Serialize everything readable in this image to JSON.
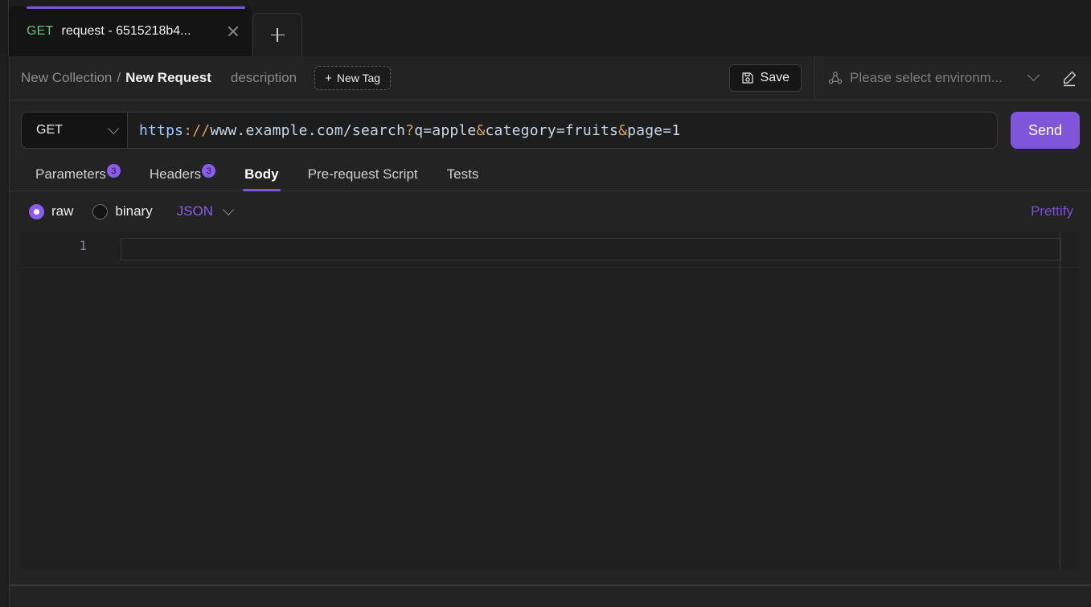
{
  "tabbar": {
    "tabs": [
      {
        "method": "GET",
        "title": "request - 6515218b4...",
        "close_icon": "close-icon",
        "active": true
      }
    ],
    "new_tab_icon": "plus-icon"
  },
  "header": {
    "collection": "New Collection",
    "separator": "/",
    "request_name": "New Request",
    "description_placeholder": "description",
    "new_tag": {
      "plus": "+",
      "label": "New Tag"
    },
    "save": {
      "label": "Save",
      "icon": "floppy-disk-icon"
    },
    "environment": {
      "icon": "environment-node-icon",
      "placeholder": "Please select environm...",
      "chevron_icon": "chevron-down-icon"
    },
    "edit_icon": "pencil-edit-icon"
  },
  "url_bar": {
    "method": "GET",
    "method_chevron_icon": "chevron-down-icon",
    "url": "https://www.example.com/search?q=apple&category=fruits&page=1",
    "url_parts": {
      "scheme": "https",
      "scheme_punct": "://",
      "host": "www.example.com",
      "path": "/search",
      "question": "?",
      "param1_key": "q",
      "eq1": "=",
      "param1_value": "apple",
      "amp1": "&",
      "param2_key": "category",
      "eq2": "=",
      "param2_value": "fruits",
      "amp2": "&",
      "param3_key": "page",
      "eq3": "=",
      "param3_value": "1"
    },
    "send_label": "Send"
  },
  "request_tabs": [
    {
      "label": "Parameters",
      "badge": "3",
      "active": false
    },
    {
      "label": "Headers",
      "badge": "3",
      "active": false
    },
    {
      "label": "Body",
      "badge": "",
      "active": true
    },
    {
      "label": "Pre-request Script",
      "badge": "",
      "active": false
    },
    {
      "label": "Tests",
      "badge": "",
      "active": false
    }
  ],
  "body_panel": {
    "raw_label": "raw",
    "binary_label": "binary",
    "selected_mode": "raw",
    "format": "JSON",
    "format_chevron_icon": "chevron-down-icon",
    "prettify_label": "Prettify",
    "editor": {
      "line_numbers": [
        "1"
      ],
      "lines": [
        ""
      ]
    }
  },
  "colors": {
    "accent_purple": "#7f56d9",
    "badge_purple": "#8a5cf0",
    "method_get_green": "#63c47b",
    "background": "#1e1e1e",
    "panel": "#232323",
    "editor": "#202020"
  }
}
